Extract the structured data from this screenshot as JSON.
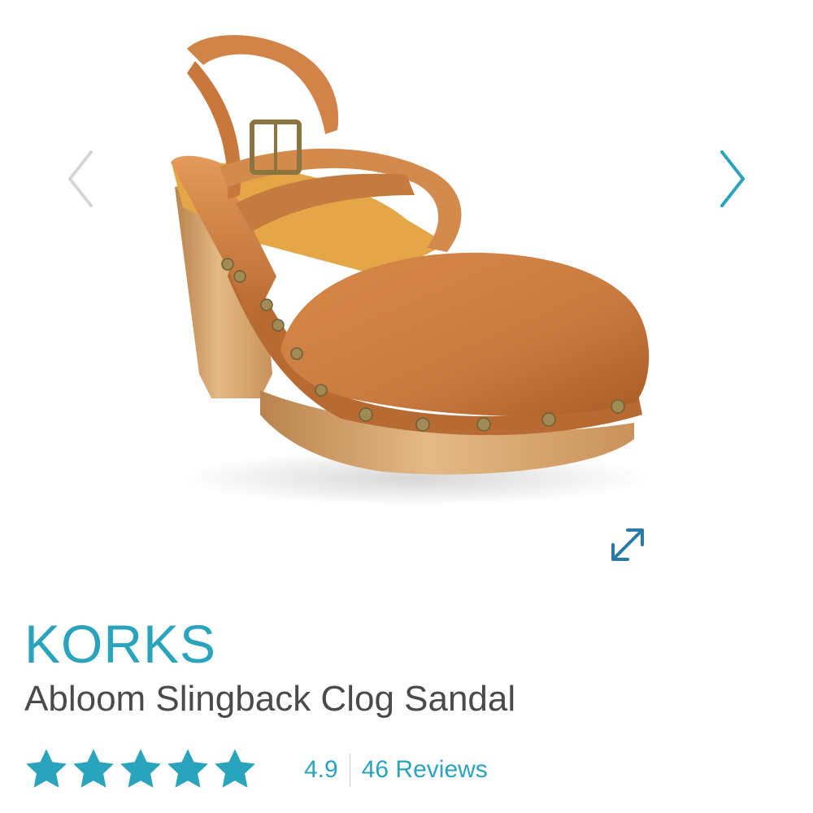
{
  "product": {
    "brand": "KORKS",
    "name": "Abloom Slingback Clog Sandal",
    "image_icon": "clog-sandal-image"
  },
  "gallery": {
    "prev_icon": "chevron-left-icon",
    "next_icon": "chevron-right-icon",
    "expand_icon": "expand-icon"
  },
  "rating": {
    "value": "4.9",
    "stars": 5,
    "stars_fraction": 0.98,
    "reviews_label": "46 Reviews"
  },
  "colors": {
    "accent": "#2aa3bd",
    "text": "#4a4a4a",
    "arrow_inactive": "#d6d6d6",
    "leather": "#c97a3f",
    "wood": "#d8a772"
  }
}
